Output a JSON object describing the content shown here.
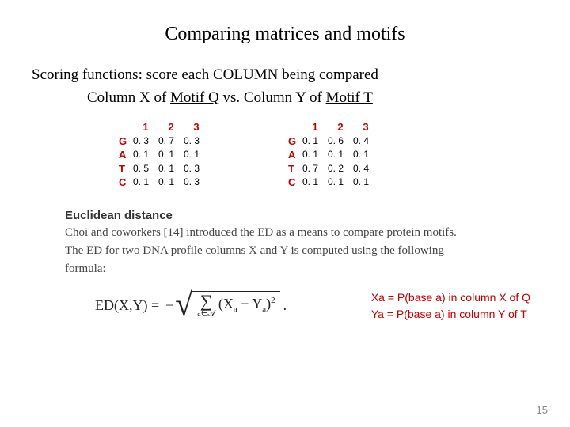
{
  "title": "Comparing matrices and motifs",
  "subtitle": {
    "line1_a": "Scoring functions:  score each COLUMN being compared",
    "line2_a": "Column X of ",
    "line2_motifQ": "Motif Q",
    "line2_b": " vs. Column Y of ",
    "line2_motifT": "Motif T"
  },
  "matrixQ": {
    "headers": [
      "1",
      "2",
      "3"
    ],
    "rows": [
      "G",
      "A",
      "T",
      "C"
    ],
    "values": [
      [
        "0. 3",
        "0. 7",
        "0. 3"
      ],
      [
        "0. 1",
        "0. 1",
        "0. 1"
      ],
      [
        "0. 5",
        "0. 1",
        "0. 3"
      ],
      [
        "0. 1",
        "0. 1",
        "0. 3"
      ]
    ]
  },
  "matrixT": {
    "headers": [
      "1",
      "2",
      "3"
    ],
    "rows": [
      "G",
      "A",
      "T",
      "C"
    ],
    "values": [
      [
        "0. 1",
        "0. 6",
        "0. 4"
      ],
      [
        "0. 1",
        "0. 1",
        "0. 1"
      ],
      [
        "0. 7",
        "0. 2",
        "0. 4"
      ],
      [
        "0. 1",
        "0. 1",
        "0. 1"
      ]
    ]
  },
  "ed": {
    "heading": "Euclidean distance",
    "body": "Choi and coworkers [14] introduced the ED as a means to compare protein motifs. The ED for two DNA profile columns X and Y is computed using the following formula:"
  },
  "formula": {
    "lhs": "ED(X,Y) = ",
    "neg": "−",
    "sum_sub": "a∈𝒜",
    "inside_a": "(X",
    "inside_sub1": "a",
    "inside_mid": " − Y",
    "inside_sub2": "a",
    "inside_b": ")",
    "sq": "2",
    "dot": "."
  },
  "legend": {
    "l1": "Xa = P(base a) in column X of Q",
    "l2": "Ya = P(base a) in column Y of T"
  },
  "page": "15"
}
